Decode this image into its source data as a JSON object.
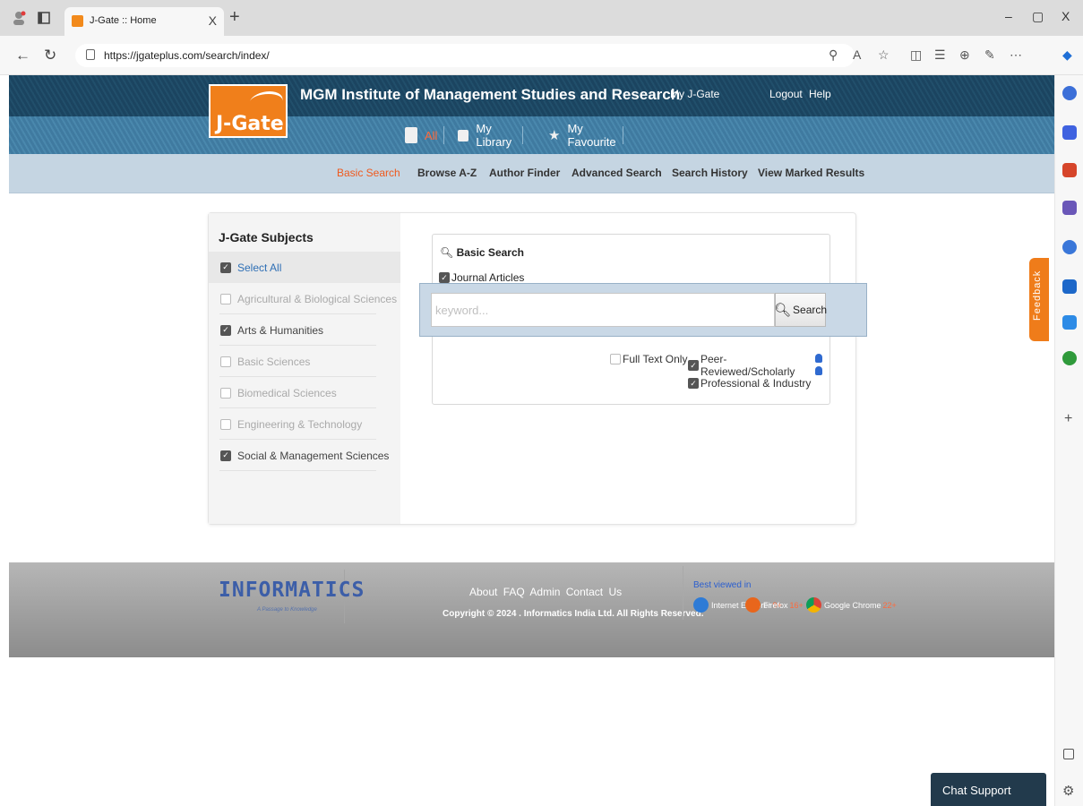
{
  "browser": {
    "tab_title": "J-Gate :: Home",
    "tab_close": "X",
    "new_tab": "+",
    "url": "https://jgateplus.com/search/index/",
    "window_controls": [
      "–",
      "▢",
      "X"
    ]
  },
  "header": {
    "logo_text": "J-Gate",
    "institution": "MGM Institute of Management Studies and Research",
    "my_jgate": "My J-Gate",
    "logout": "Logout",
    "help": "Help"
  },
  "library_tabs": {
    "all": "All",
    "my_library": "My Library",
    "my_favourite": "My Favourite"
  },
  "nav": {
    "items": [
      "Basic Search",
      "Browse A-Z",
      "Author Finder",
      "Advanced Search",
      "Search History",
      "View Marked Results"
    ],
    "active": "Basic Search"
  },
  "subjects": {
    "title": "J-Gate Subjects",
    "items": [
      {
        "label": "Select All",
        "checked": true
      },
      {
        "label": "Agricultural & Biological Sciences",
        "checked": false
      },
      {
        "label": "Arts & Humanities",
        "checked": true
      },
      {
        "label": "Basic Sciences",
        "checked": false
      },
      {
        "label": "Biomedical Sciences",
        "checked": false
      },
      {
        "label": "Engineering & Technology",
        "checked": false
      },
      {
        "label": "Social & Management Sciences",
        "checked": true
      }
    ]
  },
  "search": {
    "title": "Basic Search",
    "journal_articles": "Journal Articles",
    "placeholder": "keyword...",
    "button": "Search",
    "full_text_only": "Full Text Only",
    "peer_reviewed": "Peer-Reviewed/Scholarly",
    "professional": "Professional & Industry"
  },
  "footer": {
    "logo": "INFORMATICS",
    "tagline": "A Passage to Knowledge",
    "links": [
      "About",
      "FAQ",
      "Admin",
      "Contact Us"
    ],
    "copyright": "Copyright © 2024 . Informatics India Ltd. All Rights Reserved.",
    "best_viewed": "Best viewed in",
    "browsers": [
      {
        "name": "Internet Explorer",
        "version": "9+"
      },
      {
        "name": "Firefox",
        "version": "16+"
      },
      {
        "name": "Google Chrome",
        "version": "22+"
      }
    ]
  },
  "widgets": {
    "feedback": "Feedback",
    "chat": "Chat Support"
  },
  "colors": {
    "brand_orange": "#f07f1b",
    "header_blue": "#214f6b",
    "active_nav": "#ef5a1e"
  }
}
